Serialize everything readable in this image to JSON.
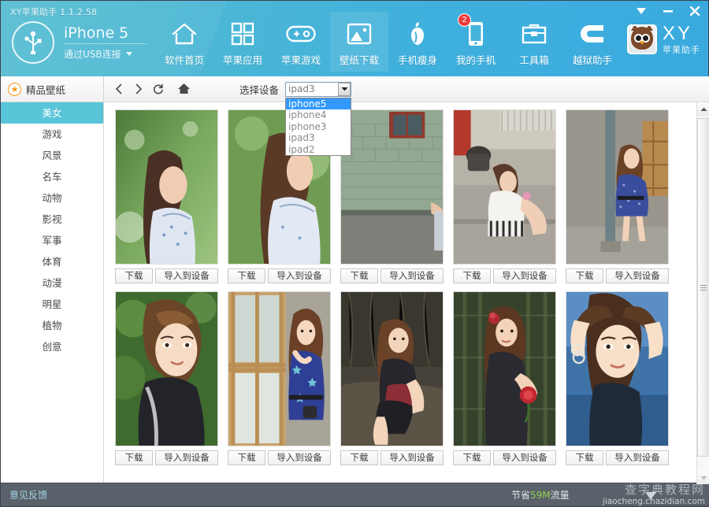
{
  "window": {
    "app_version_title": "XY苹果助手 1.1.2.58",
    "controls": {
      "tray_label": "▼",
      "minimize_label": "—",
      "close_label": "✕"
    }
  },
  "device": {
    "name": "iPhone 5",
    "connection": "通过USB连接",
    "usb_icon": "usb-icon",
    "caret_icon": "chevron-down-icon"
  },
  "nav": {
    "items": [
      {
        "label": "软件首页",
        "icon": "home-icon",
        "active": false,
        "badge": ""
      },
      {
        "label": "苹果应用",
        "icon": "grid-apps-icon",
        "active": false,
        "badge": ""
      },
      {
        "label": "苹果游戏",
        "icon": "gamepad-icon",
        "active": false,
        "badge": ""
      },
      {
        "label": "壁纸下载",
        "icon": "picture-icon",
        "active": true,
        "badge": ""
      },
      {
        "label": "手机瘦身",
        "icon": "apple-slim-icon",
        "active": false,
        "badge": ""
      },
      {
        "label": "我的手机",
        "icon": "phone-icon",
        "active": false,
        "badge": "2"
      },
      {
        "label": "工具箱",
        "icon": "toolbox-icon",
        "active": false,
        "badge": ""
      },
      {
        "label": "越狱助手",
        "icon": "jailbreak-icon",
        "active": false,
        "badge": ""
      }
    ]
  },
  "brand": {
    "logo_icon": "owl-mascot-icon",
    "name": "XY",
    "subtitle": "苹果助手"
  },
  "sidebar": {
    "header_label": "精品壁纸",
    "header_icon": "star-icon",
    "items": [
      {
        "label": "美女",
        "active": true
      },
      {
        "label": "游戏",
        "active": false
      },
      {
        "label": "风景",
        "active": false
      },
      {
        "label": "名车",
        "active": false
      },
      {
        "label": "动物",
        "active": false
      },
      {
        "label": "影视",
        "active": false
      },
      {
        "label": "军事",
        "active": false
      },
      {
        "label": "体育",
        "active": false
      },
      {
        "label": "动漫",
        "active": false
      },
      {
        "label": "明星",
        "active": false
      },
      {
        "label": "植物",
        "active": false
      },
      {
        "label": "创意",
        "active": false
      }
    ]
  },
  "toolbar": {
    "back_icon": "chevron-left-icon",
    "forward_icon": "chevron-right-icon",
    "refresh_icon": "refresh-icon",
    "home_icon": "home-icon",
    "select_device_label": "选择设备",
    "device_select": {
      "value": "ipad3",
      "expanded": true,
      "selected_option": "iphone5",
      "options": [
        "iphone5",
        "iphone4",
        "iphone3",
        "ipad3",
        "ipad2"
      ]
    }
  },
  "gallery": {
    "download_label": "下载",
    "import_label": "导入到设备",
    "items": [
      {
        "id": "wp-1",
        "alt": "girl-in-blue-floral-dress-green-bokeh"
      },
      {
        "id": "wp-2",
        "alt": "girl-blue-strap-dress-side-profile"
      },
      {
        "id": "wp-3",
        "alt": "girl-by-green-brick-wall"
      },
      {
        "id": "wp-4",
        "alt": "girl-sitting-on-steps-striped-shorts"
      },
      {
        "id": "wp-5",
        "alt": "girl-in-blue-dress-by-pole"
      },
      {
        "id": "wp-6",
        "alt": "girl-close-up-black-top-green-background"
      },
      {
        "id": "wp-7",
        "alt": "girl-in-starry-blue-dress-by-window"
      },
      {
        "id": "wp-8",
        "alt": "girl-sitting-in-forest-black-outfit"
      },
      {
        "id": "wp-9",
        "alt": "girl-holding-red-rose-in-woods"
      },
      {
        "id": "wp-10",
        "alt": "girl-arms-raised-blue-background"
      }
    ]
  },
  "scrollbar": {
    "up_icon": "triangle-up-icon",
    "down_icon": "triangle-down-icon",
    "thumb_grip_icon": "grip-icon"
  },
  "statusbar": {
    "feedback_label": "意见反馈",
    "traffic_prefix": "节省",
    "traffic_value": "59M",
    "traffic_suffix": "流量",
    "watermark_cn": "查字典教程网",
    "watermark_en": "jiaocheng.chazidian.com"
  },
  "colors": {
    "header_accent": "#45b4da",
    "sidebar_active": "#58c5d8",
    "badge_red": "#ef3b3b",
    "star_orange": "#f09a16",
    "select_highlight": "#3399ff",
    "status_bg": "#5b616a",
    "traffic_green": "#8fd14f"
  }
}
